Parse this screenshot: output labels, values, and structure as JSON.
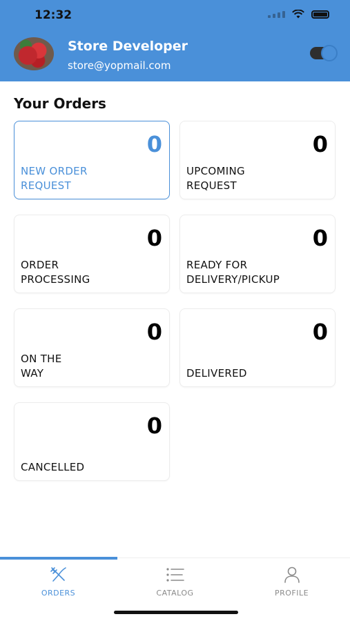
{
  "status_bar": {
    "time": "12:32"
  },
  "header": {
    "name": "Store Developer",
    "email": "store@yopmail.com",
    "toggle_on": true
  },
  "section_title": "Your Orders",
  "cards": [
    {
      "count": "0",
      "label_line1": "NEW ORDER",
      "label_line2": "REQUEST"
    },
    {
      "count": "0",
      "label_line1": "UPCOMING",
      "label_line2": "REQUEST"
    },
    {
      "count": "0",
      "label_line1": "ORDER",
      "label_line2": "PROCESSING"
    },
    {
      "count": "0",
      "label_line1": "READY FOR",
      "label_line2": "DELIVERY/PICKUP"
    },
    {
      "count": "0",
      "label_line1": "ON THE",
      "label_line2": "WAY"
    },
    {
      "count": "0",
      "label_line1": "",
      "label_line2": "DELIVERED"
    },
    {
      "count": "0",
      "label_line1": "",
      "label_line2": "CANCELLED"
    }
  ],
  "tabs": [
    {
      "label": "ORDERS",
      "icon": "fork-knife-icon",
      "active": true
    },
    {
      "label": "CATALOG",
      "icon": "list-icon",
      "active": false
    },
    {
      "label": "PROFILE",
      "icon": "user-icon",
      "active": false
    }
  ],
  "colors": {
    "primary": "#4a90d9",
    "text": "#111111",
    "inactive": "#8a8a8a"
  }
}
